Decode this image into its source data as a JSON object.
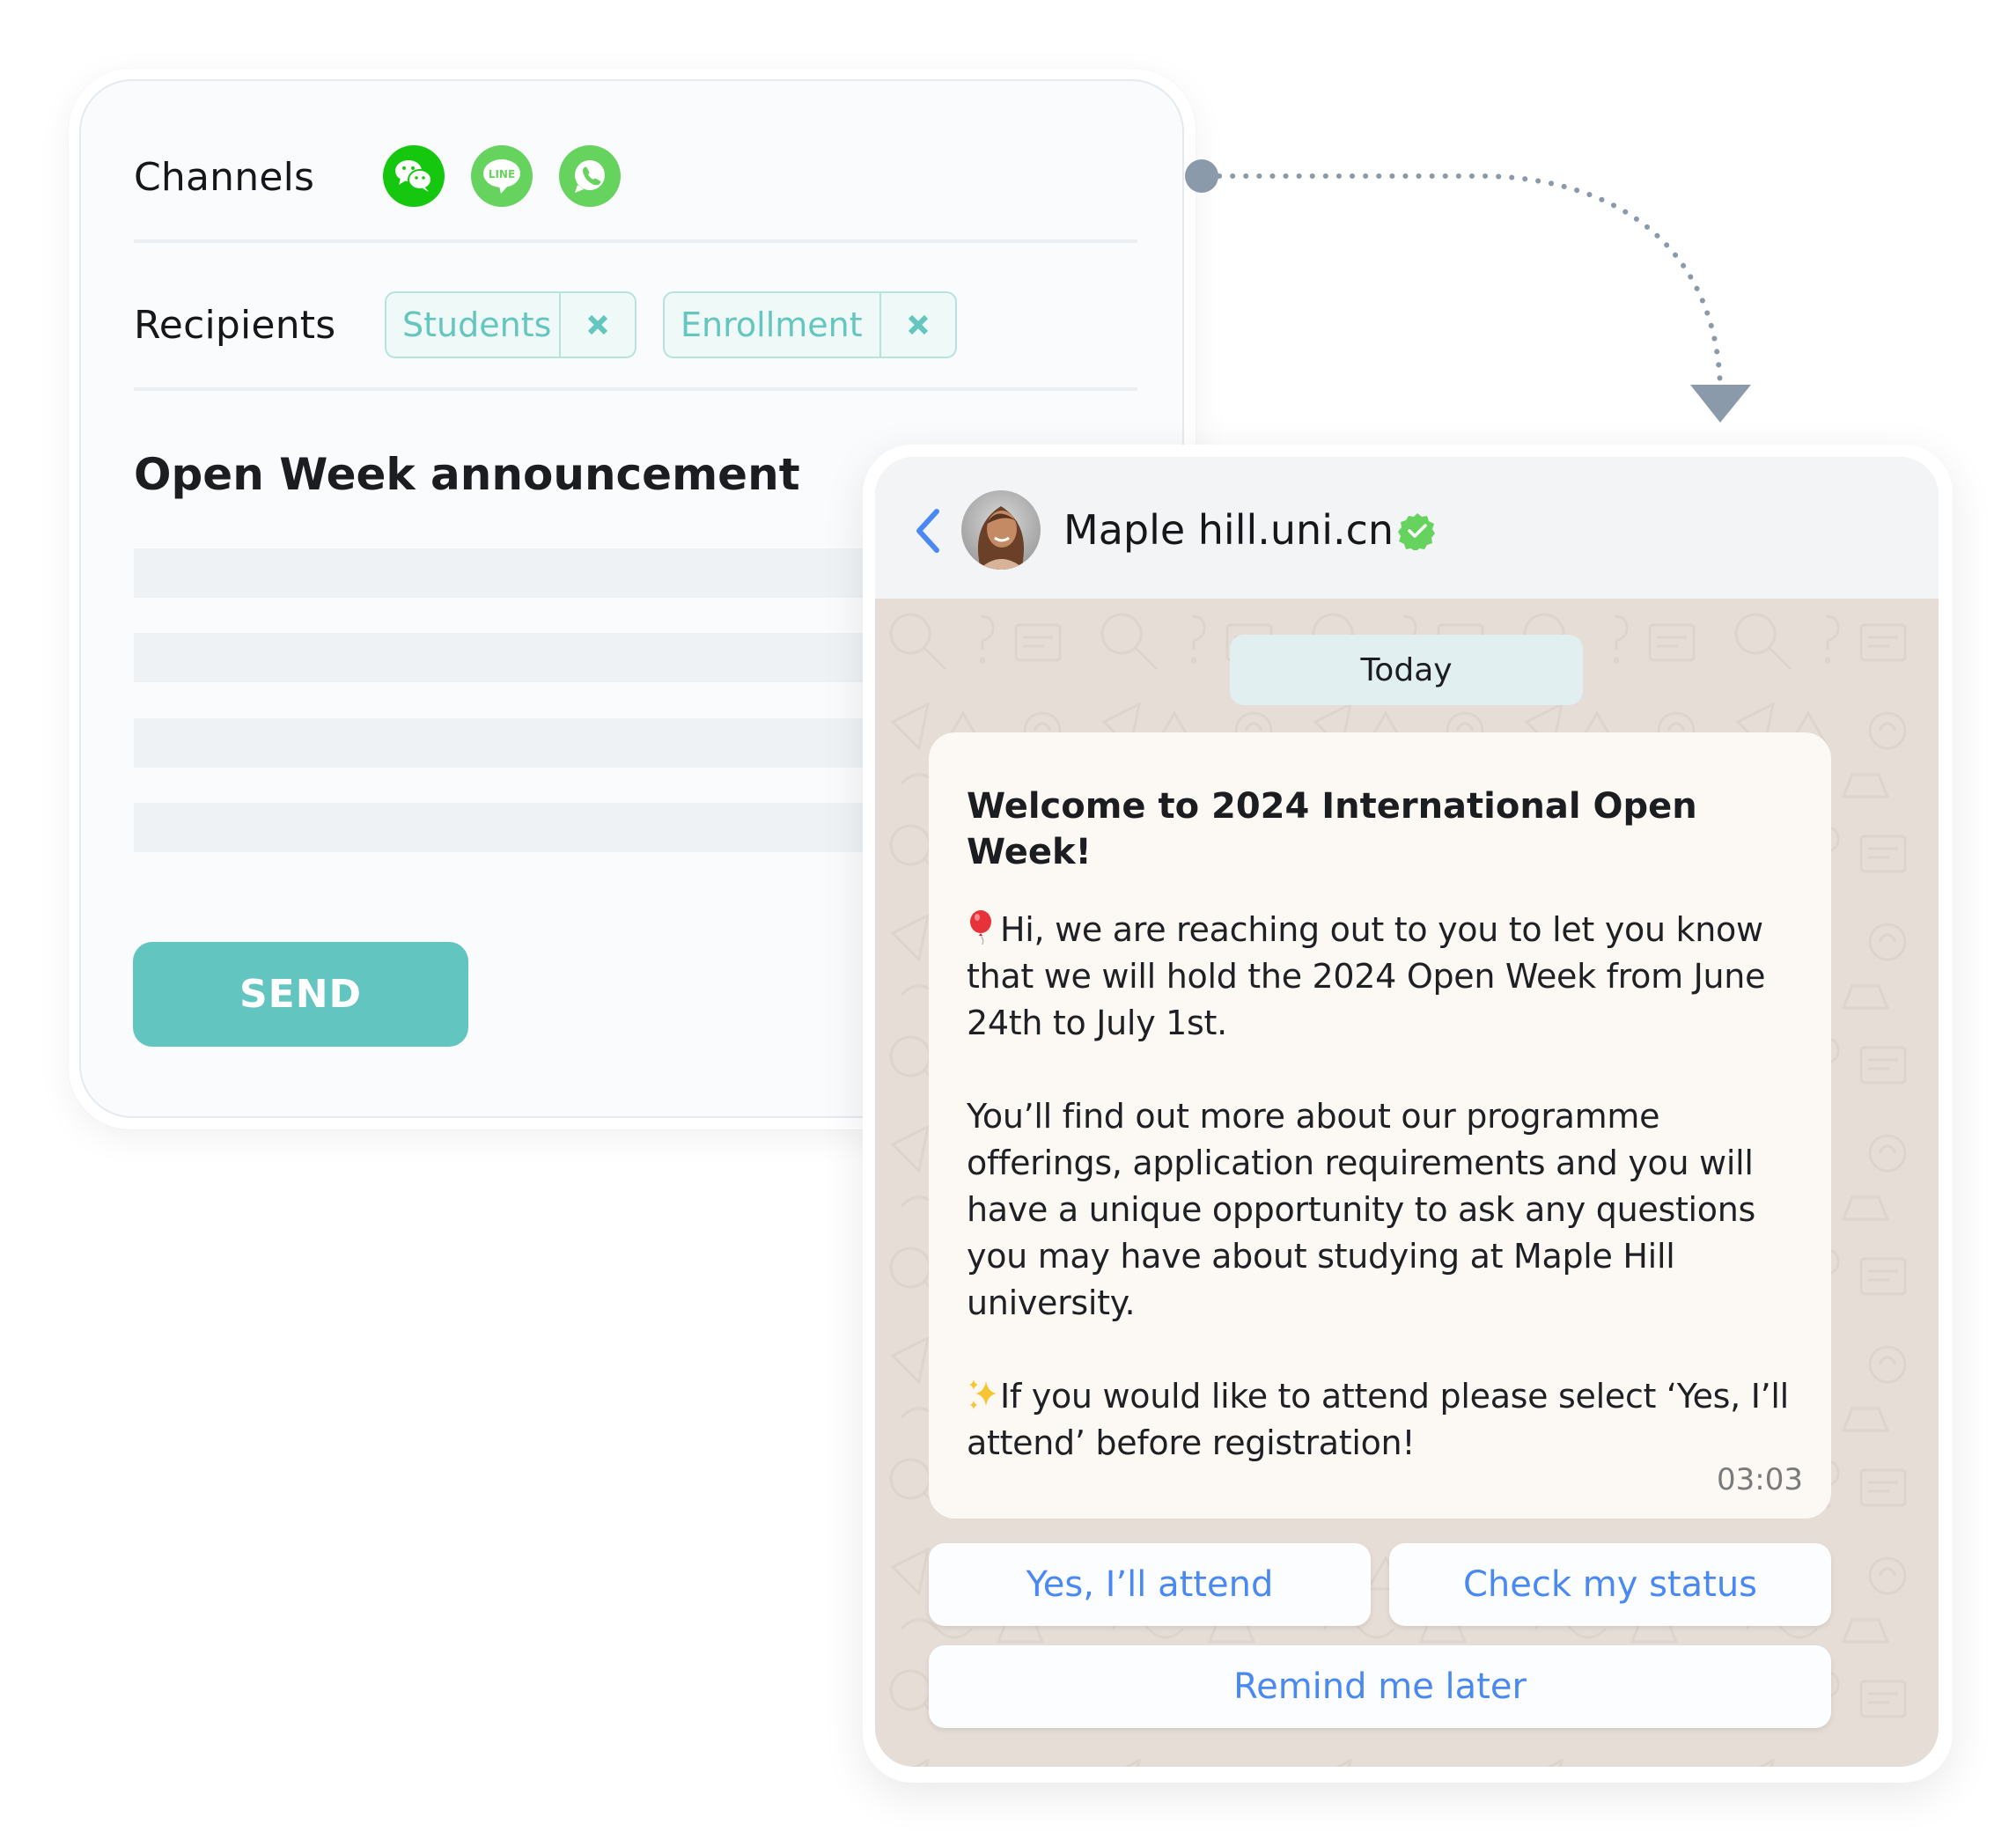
{
  "composer": {
    "channels_label": "Channels",
    "channels": [
      {
        "name": "WeChat",
        "icon": "wechat-icon",
        "color": "#15c80f"
      },
      {
        "name": "LINE",
        "icon": "line-icon",
        "color": "#67d35f",
        "glyph_text": "LINE"
      },
      {
        "name": "WhatsApp",
        "icon": "whatsapp-icon",
        "color": "#67d35f"
      }
    ],
    "recipients_label": "Recipients",
    "recipients": [
      {
        "label": "Students",
        "remove_icon": "close-icon"
      },
      {
        "label": "Enrollment",
        "remove_icon": "close-icon"
      }
    ],
    "title": "Open Week announcement",
    "send_label": "SEND",
    "accent_color": "#63c5bf"
  },
  "chat": {
    "back_icon": "chevron-left-icon",
    "contact_name": "Maple hill.uni.cn",
    "verified_icon": "verified-badge-icon",
    "date_label": "Today",
    "message": {
      "title": "Welcome to 2024 International Open Week!",
      "paragraph_1_emoji": "balloon-icon",
      "paragraph_1": "Hi, we are reaching out to you to let you know that we will hold the 2024 Open Week from June 24th to July 1st.",
      "paragraph_2": "You’ll find out more about our programme offerings, application requirements and you will have a unique opportunity to ask any questions you may have about studying at Maple Hill university.",
      "paragraph_3_emoji": "sparkles-icon",
      "paragraph_3": "If you would like to attend please select ‘Yes, I’ll attend’ before registration!",
      "time": "03:03"
    },
    "quick_replies": [
      {
        "label": "Yes, I’ll attend"
      },
      {
        "label": "Check my status"
      },
      {
        "label": "Remind me later"
      }
    ],
    "link_color": "#4a89f3"
  }
}
